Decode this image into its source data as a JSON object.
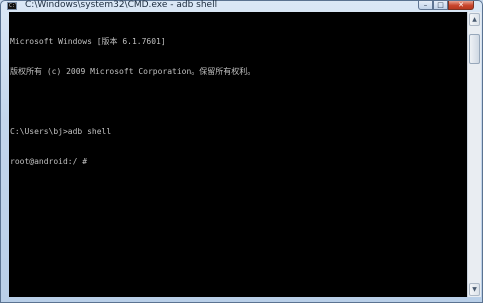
{
  "window": {
    "title": "C:\\Windows\\system32\\CMD.exe - adb  shell",
    "app_icon": "command-prompt-icon",
    "app_icon_text": "C:\\"
  },
  "controls": {
    "minimize": "minimize-icon",
    "maximize": "maximize-icon",
    "close": "close-icon",
    "minimize_glyph": "–",
    "maximize_glyph": "□",
    "close_glyph": "✕"
  },
  "console": {
    "lines": [
      "Microsoft Windows [版本 6.1.7601]",
      "版权所有 (c) 2009 Microsoft Corporation。保留所有权利。",
      "",
      "C:\\Users\\bj>adb shell",
      "root@android:/ #"
    ],
    "text_color": "#c0c0c0",
    "background_color": "#000000"
  },
  "scrollbar": {
    "up_glyph": "▲",
    "down_glyph": "▼",
    "position_fraction": 0.0
  }
}
